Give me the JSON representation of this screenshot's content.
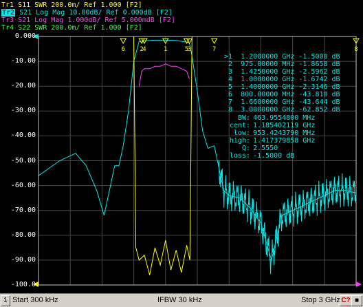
{
  "traces": [
    {
      "label": "Tr1",
      "param": "S11",
      "format": "SWR",
      "scale": "200.0m/",
      "ref": "Ref 1.000",
      "tag": "[F2]",
      "color": "#ffff00",
      "active": false
    },
    {
      "label": "Tr2",
      "param": "S21",
      "format": "Log Mag",
      "scale": "10.00dB/",
      "ref": "Ref 0.000dB",
      "tag": "[F2]",
      "color": "#00e8e8",
      "active": true
    },
    {
      "label": "Tr3",
      "param": "S21",
      "format": "Log Mag",
      "scale": "1.000dB/",
      "ref": "Ref 5.000mdB",
      "tag": "[F2]",
      "color": "#ff40ff",
      "active": false
    },
    {
      "label": "Tr4",
      "param": "S22",
      "format": "SWR",
      "scale": "200.0m/",
      "ref": "Ref 1.000",
      "tag": "[F2]",
      "color": "#40ff40",
      "active": false
    }
  ],
  "y_ticks": [
    "0.000",
    "-10.00",
    "-20.00",
    "-30.00",
    "-40.00",
    "-50.00",
    "-60.00",
    "-70.00",
    "-80.00",
    "-90.00",
    "-100.0"
  ],
  "markers": [
    {
      "num": ">1",
      "freq": "1.2000000 GHz",
      "value": "-1.5000 dB"
    },
    {
      "num": "2",
      "freq": "975.00000 MHz",
      "value": "-1.8658 dB"
    },
    {
      "num": "3",
      "freq": "1.4250000 GHz",
      "value": "-2.5962 dB"
    },
    {
      "num": "4",
      "freq": "1.0000000 GHz",
      "value": "-1.6742 dB"
    },
    {
      "num": "5",
      "freq": "1.4000000 GHz",
      "value": "-2.3146 dB"
    },
    {
      "num": "6",
      "freq": "800.00000 MHz",
      "value": "-43.810 dB"
    },
    {
      "num": "7",
      "freq": "1.6600000 GHz",
      "value": "-43.644 dB"
    },
    {
      "num": "8",
      "freq": "3.0000000 GHz",
      "value": "-62.852 dB"
    }
  ],
  "bandwidth": [
    {
      "label": "BW:",
      "value": "463.9554800 MHz"
    },
    {
      "label": "cent:",
      "value": "1.185402119 GHz"
    },
    {
      "label": "low:",
      "value": "953.4243790 MHz"
    },
    {
      "label": "high:",
      "value": "1.417379858 GHz"
    },
    {
      "label": "Q:",
      "value": "2.5550"
    },
    {
      "label": "loss:",
      "value": "-1.5000 dB"
    }
  ],
  "marker_flags": {
    "top": [
      "6",
      "2",
      "4",
      "1",
      "5",
      "3",
      "7",
      "8"
    ]
  },
  "statusbar": {
    "channel": "1",
    "start": "Start 300 kHz",
    "ifbw": "IFBW 30 kHz",
    "stop": "Stop 3 GHz",
    "cal": "C?"
  },
  "colors": {
    "tr1": "#ffff00",
    "tr2": "#00e8e8",
    "tr3": "#ff40ff",
    "tr4": "#40ff40",
    "grid": "#4a4a4a",
    "frame": "#c8c8c8"
  },
  "chart_data": {
    "type": "line",
    "xlim_ghz": [
      0.0003,
      3.0
    ],
    "ylim_db": [
      -100,
      0
    ],
    "grid": true,
    "series": [
      {
        "name": "S21",
        "x": [
          0.0003,
          0.2,
          0.35,
          0.45,
          0.55,
          0.62,
          0.68,
          0.72,
          0.76,
          0.8,
          0.85,
          0.9,
          0.95,
          0.975,
          1.0,
          1.1,
          1.2,
          1.3,
          1.4,
          1.425,
          1.45,
          1.5,
          1.55,
          1.6,
          1.66,
          1.7,
          1.75,
          1.8,
          1.9,
          2.0,
          2.1,
          2.2,
          2.3,
          2.4,
          2.5,
          2.6,
          2.7,
          2.8,
          2.9,
          3.0
        ],
        "y": [
          -56,
          -50,
          -47,
          -52,
          -62,
          -72,
          -60,
          -52,
          -52,
          -44,
          -30,
          -10,
          -2,
          -1.9,
          -1.7,
          -1.5,
          -1.5,
          -1.6,
          -2.3,
          -2.6,
          -8,
          -22,
          -38,
          -45,
          -44,
          -52,
          -62,
          -64,
          -65,
          -69,
          -75,
          -90,
          -72,
          -70,
          -68,
          -66,
          -64,
          -62,
          -62,
          -63
        ]
      },
      {
        "name": "S11",
        "x": [
          0.0003,
          0.9,
          0.92,
          0.95,
          1.0,
          1.05,
          1.1,
          1.15,
          1.2,
          1.25,
          1.3,
          1.35,
          1.4,
          1.43,
          1.45,
          3.0
        ],
        "y": [
          0,
          0,
          -85,
          -90,
          -88,
          -96,
          -85,
          -92,
          -82,
          -94,
          -86,
          -95,
          -84,
          -90,
          0,
          0
        ]
      },
      {
        "name": "S21 1dB",
        "x": [
          0.95,
          0.975,
          1.0,
          1.05,
          1.1,
          1.15,
          1.2,
          1.25,
          1.3,
          1.35,
          1.4,
          1.425
        ],
        "y": [
          -20,
          -14,
          -13,
          -13,
          -12,
          -12,
          -11,
          -12,
          -12,
          -13,
          -14,
          -17
        ]
      }
    ]
  }
}
